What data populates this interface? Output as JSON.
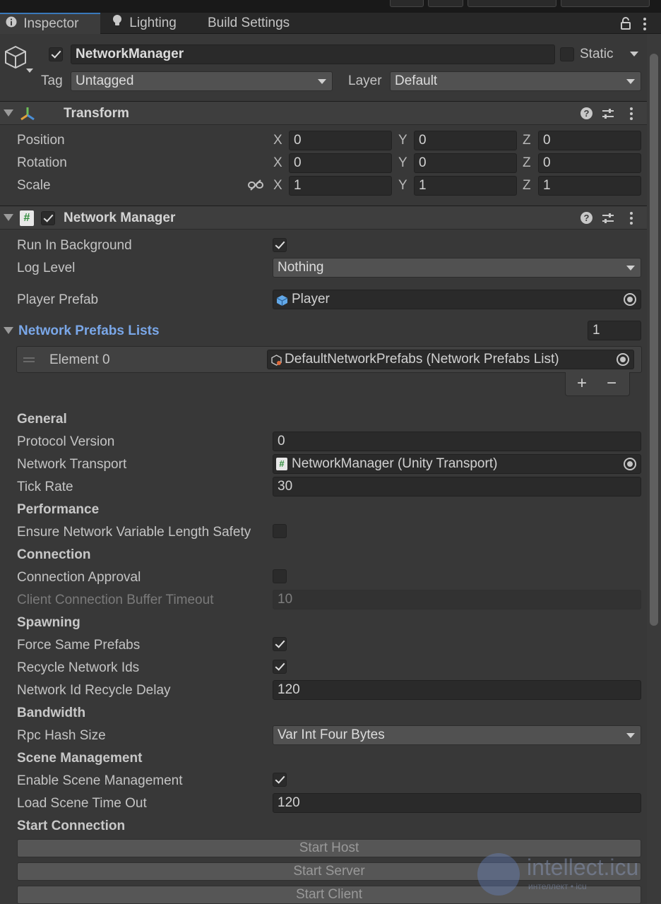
{
  "tabs": [
    {
      "label": "Inspector",
      "active": true
    },
    {
      "label": "Lighting",
      "active": false
    },
    {
      "label": "Build Settings",
      "active": false
    }
  ],
  "object": {
    "name": "NetworkManager",
    "active": true,
    "static_label": "Static",
    "tag_label": "Tag",
    "tag_value": "Untagged",
    "layer_label": "Layer",
    "layer_value": "Default"
  },
  "transform": {
    "title": "Transform",
    "position_label": "Position",
    "rotation_label": "Rotation",
    "scale_label": "Scale",
    "axes": [
      "X",
      "Y",
      "Z"
    ],
    "position": [
      "0",
      "0",
      "0"
    ],
    "rotation": [
      "0",
      "0",
      "0"
    ],
    "scale": [
      "1",
      "1",
      "1"
    ]
  },
  "network_manager": {
    "title": "Network Manager",
    "enabled": true,
    "run_in_background_label": "Run In Background",
    "run_in_background": true,
    "log_level_label": "Log Level",
    "log_level_value": "Nothing",
    "player_prefab_label": "Player Prefab",
    "player_prefab_value": "Player",
    "prefabs_lists_label": "Network Prefabs Lists",
    "prefabs_lists_count": "1",
    "element0_label": "Element 0",
    "element0_value": "DefaultNetworkPrefabs (Network Prefabs List)",
    "add_symbol": "+",
    "remove_symbol": "−"
  },
  "general": {
    "title": "General",
    "protocol_version_label": "Protocol Version",
    "protocol_version": "0",
    "network_transport_label": "Network Transport",
    "network_transport": "NetworkManager (Unity Transport)",
    "tick_rate_label": "Tick Rate",
    "tick_rate": "30"
  },
  "performance": {
    "title": "Performance",
    "ensure_label": "Ensure Network Variable Length Safety",
    "ensure": false
  },
  "connection": {
    "title": "Connection",
    "approval_label": "Connection Approval",
    "approval": false,
    "buffer_timeout_label": "Client Connection Buffer Timeout",
    "buffer_timeout": "10"
  },
  "spawning": {
    "title": "Spawning",
    "force_same_label": "Force Same Prefabs",
    "force_same": true,
    "recycle_label": "Recycle Network Ids",
    "recycle": true,
    "recycle_delay_label": "Network Id Recycle Delay",
    "recycle_delay": "120"
  },
  "bandwidth": {
    "title": "Bandwidth",
    "rpc_hash_label": "Rpc Hash Size",
    "rpc_hash_value": "Var Int Four Bytes"
  },
  "scene_management": {
    "title": "Scene Management",
    "enable_label": "Enable Scene Management",
    "enable": true,
    "load_timeout_label": "Load Scene Time Out",
    "load_timeout": "120"
  },
  "start_connection": {
    "title": "Start Connection",
    "host": "Start Host",
    "server": "Start Server",
    "client": "Start Client"
  },
  "watermark": {
    "text": "intellect.icu",
    "subtext": "интеллект • icu"
  },
  "colors": {
    "background": "#383838",
    "accent_blue": "#3a79bb",
    "link_blue": "#7aa7e8",
    "field": "#2a2a2a"
  }
}
